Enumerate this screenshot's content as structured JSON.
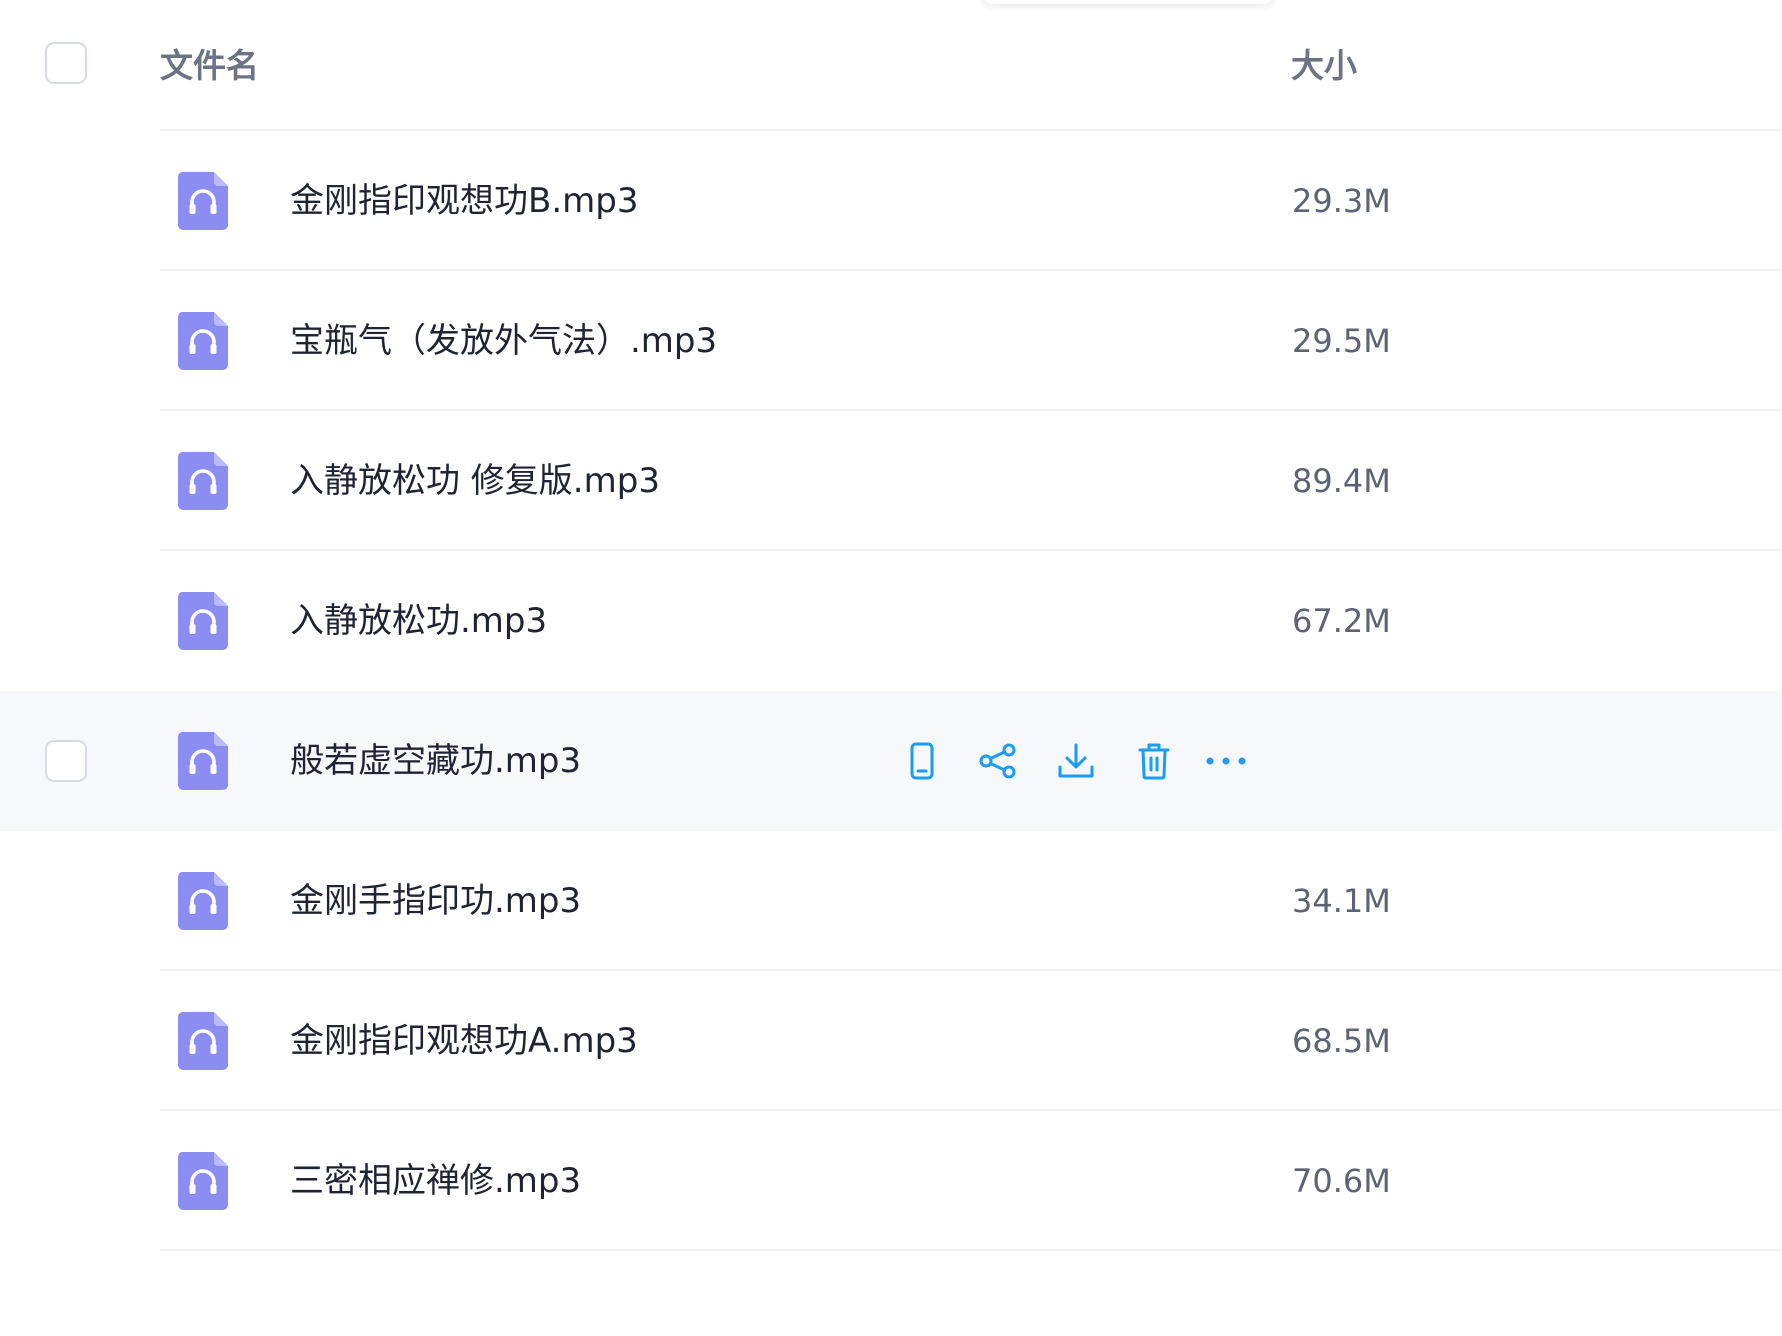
{
  "header": {
    "name_label": "文件名",
    "size_label": "大小"
  },
  "colors": {
    "accent": "#1a9df2",
    "file_icon": "#8b8df3",
    "hover_row": "#f6f8fb"
  },
  "files": [
    {
      "name": "金刚指印观想功B.mp3",
      "size": "29.3M",
      "icon": "audio-file-icon"
    },
    {
      "name": "宝瓶气（发放外气法）.mp3",
      "size": "29.5M",
      "icon": "audio-file-icon"
    },
    {
      "name": "入静放松功 修复版.mp3",
      "size": "89.4M",
      "icon": "audio-file-icon"
    },
    {
      "name": "入静放松功.mp3",
      "size": "67.2M",
      "icon": "audio-file-icon"
    },
    {
      "name": "般若虚空藏功.mp3",
      "size": "",
      "icon": "audio-file-icon",
      "hovered": true
    },
    {
      "name": "金刚手指印功.mp3",
      "size": "34.1M",
      "icon": "audio-file-icon"
    },
    {
      "name": "金刚指印观想功A.mp3",
      "size": "68.5M",
      "icon": "audio-file-icon"
    },
    {
      "name": "三密相应禅修.mp3",
      "size": "70.6M",
      "icon": "audio-file-icon"
    }
  ],
  "hover_actions": [
    "phone-icon",
    "share-icon",
    "download-icon",
    "trash-icon",
    "more-icon"
  ]
}
